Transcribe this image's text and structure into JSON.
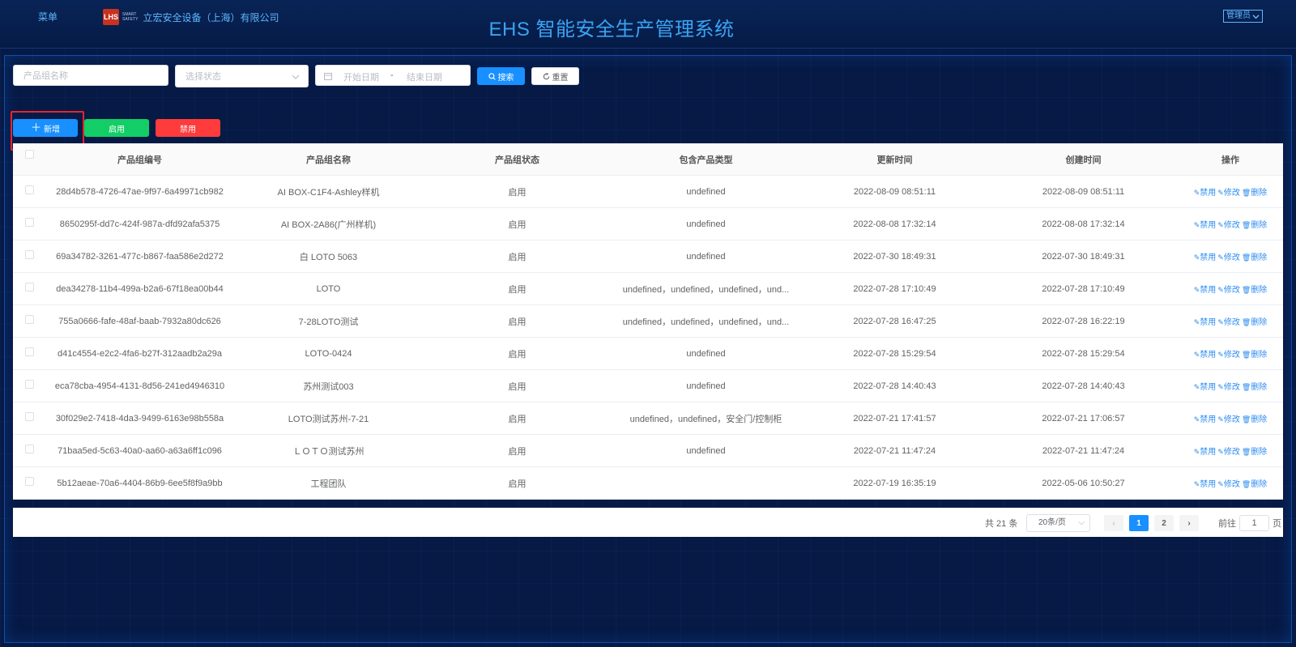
{
  "header": {
    "menu": "菜单",
    "company": "立宏安全设备（上海）有限公司",
    "title": "EHS 智能安全生产管理系统",
    "admin": "管理员",
    "logo_text": "LHS",
    "logo_tag1": "SMART",
    "logo_tag2": "SAFETY"
  },
  "filters": {
    "name_placeholder": "产品组名称",
    "status_placeholder": "选择状态",
    "start_date": "开始日期",
    "date_sep": "-",
    "end_date": "结束日期",
    "search": "搜索",
    "reset": "重置"
  },
  "actions": {
    "add": "新增",
    "enable": "启用",
    "disable": "禁用"
  },
  "colors": {
    "add": "#1890ff",
    "enable": "#13ce66",
    "disable": "#ff3b3b",
    "search": "#1890ff",
    "title": "#3aa3f2"
  },
  "table": {
    "columns": [
      "产品组编号",
      "产品组名称",
      "产品组状态",
      "包含产品类型",
      "更新时间",
      "创建时间",
      "操作"
    ],
    "op_labels": {
      "disable": "禁用",
      "edit": "修改",
      "delete": "删除"
    },
    "rows": [
      [
        "28d4b578-4726-47ae-9f97-6a49971cb982",
        "AI BOX-C1F4-Ashley样机",
        "启用",
        "undefined",
        "2022-08-09 08:51:11",
        "2022-08-09 08:51:11"
      ],
      [
        "8650295f-dd7c-424f-987a-dfd92afa5375",
        "AI BOX-2A86(广州样机)",
        "启用",
        "undefined",
        "2022-08-08 17:32:14",
        "2022-08-08 17:32:14"
      ],
      [
        "69a34782-3261-477c-b867-faa586e2d272",
        "白 LOTO 5063",
        "启用",
        "undefined",
        "2022-07-30 18:49:31",
        "2022-07-30 18:49:31"
      ],
      [
        "dea34278-11b4-499a-b2a6-67f18ea00b44",
        "LOTO",
        "启用",
        "undefined，undefined，undefined，und...",
        "2022-07-28 17:10:49",
        "2022-07-28 17:10:49"
      ],
      [
        "755a0666-fafe-48af-baab-7932a80dc626",
        "7-28LOTO测试",
        "启用",
        "undefined，undefined，undefined，und...",
        "2022-07-28 16:47:25",
        "2022-07-28 16:22:19"
      ],
      [
        "d41c4554-e2c2-4fa6-b27f-312aadb2a29a",
        "LOTO-0424",
        "启用",
        "undefined",
        "2022-07-28 15:29:54",
        "2022-07-28 15:29:54"
      ],
      [
        "eca78cba-4954-4131-8d56-241ed4946310",
        "苏州测试003",
        "启用",
        "undefined",
        "2022-07-28 14:40:43",
        "2022-07-28 14:40:43"
      ],
      [
        "30f029e2-7418-4da3-9499-6163e98b558a",
        "LOTO测试苏州-7-21",
        "启用",
        "undefined，undefined，安全门/控制柜",
        "2022-07-21 17:41:57",
        "2022-07-21 17:06:57"
      ],
      [
        "71baa5ed-5c63-40a0-aa60-a63a6ff1c096",
        "ＬＯＴＯ测试苏州",
        "启用",
        "undefined",
        "2022-07-21 11:47:24",
        "2022-07-21 11:47:24"
      ],
      [
        "5b12aeae-70a6-4404-86b9-6ee5f8f9a9bb",
        "工程团队",
        "启用",
        "",
        "2022-07-19 16:35:19",
        "2022-05-06 10:50:27"
      ]
    ]
  },
  "pagination": {
    "total": "共 21 条",
    "page_size": "20条/页",
    "pages": [
      "1",
      "2"
    ],
    "current": "1",
    "goto_label": "前往",
    "goto_value": "1",
    "page_suffix": "页"
  }
}
